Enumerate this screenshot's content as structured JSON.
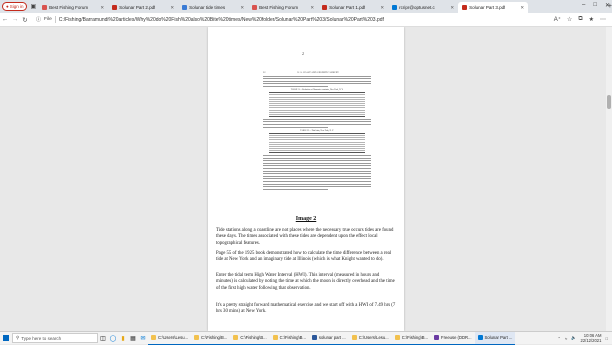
{
  "browser": {
    "signin_label": "Sign in",
    "tabs": [
      {
        "title": "Best Fishing Forum",
        "color": "#d9534f"
      },
      {
        "title": "Solunar Part 2.pdf",
        "color": "#c42b1c"
      },
      {
        "title": "Solunar tide times",
        "color": "#3a7bd5"
      },
      {
        "title": "Best Fishing Forum",
        "color": "#d9534f"
      },
      {
        "title": "Solunar Part 1.pdf",
        "color": "#c42b1c"
      },
      {
        "title": "rcripr@optusnet.c",
        "color": "#0078d4"
      },
      {
        "title": "Solunar Part 3.pdf",
        "color": "#c42b1c"
      }
    ],
    "new_tab": "+",
    "file_label": "File",
    "url": "C:/Fishing/Barramundi%20articles/Why%20do%20Fish%20also%20Bite%20times/New%20folder/Solunar%20Part%203/Solunar%20Part%203.pdf"
  },
  "document": {
    "page_number": "2",
    "scan_header_left": "32",
    "scan_header_center": "U. S. COAST AND GEODETIC SURVEY",
    "table_caption_1": "TABLE 21.—Reduction of Harmonic constants, New York, N. Y.",
    "table_caption_2": "TABLE 22.—Tidal data, New York, N. Y.",
    "caption": "Image 2",
    "paragraphs": [
      "Tide stations along a coastline are not places where the necessary true occurs tides are found these days. The times associated with these tides are dependent upon the effect local topographical features.",
      "Page 55 of the 1925 book demonstrated how to calculate the time difference between a real tide at New York and an imaginary tide at Illinois (which is what Knight wanted to do).",
      "Enter the tidal term High Water Interval (HWI). This interval (measured in hours and minutes) is calculated by noting the time at which the moon is directly overhead and the time of the first high water following that observation.",
      "It's a pretty straight forward mathematical exercise and we start off with a HWI of 7.49 hrs (7 hrs 30 mins) at New York."
    ]
  },
  "taskbar": {
    "search_placeholder": "Type here to search",
    "apps": [
      {
        "label": "C:\\Users\\Lesu...",
        "color": "#f2c14e"
      },
      {
        "label": "C:\\Fishing\\B...",
        "color": "#f2c14e"
      },
      {
        "label": "C:\\Fishing\\B...",
        "color": "#f2c14e"
      },
      {
        "label": "C:\\Fishing\\B...",
        "color": "#f2c14e"
      },
      {
        "label": "solunar part ...",
        "color": "#2b579a"
      },
      {
        "label": "C:\\Users\\Lesu...",
        "color": "#f2c14e"
      },
      {
        "label": "C:\\Fishing\\B...",
        "color": "#f2c14e"
      },
      {
        "label": "Freeuse (DDR...",
        "color": "#6a3aa2"
      },
      {
        "label": "Solunar Part ...",
        "color": "#0078d4"
      }
    ],
    "time": "10:06 AM",
    "date": "22/12/2021"
  }
}
